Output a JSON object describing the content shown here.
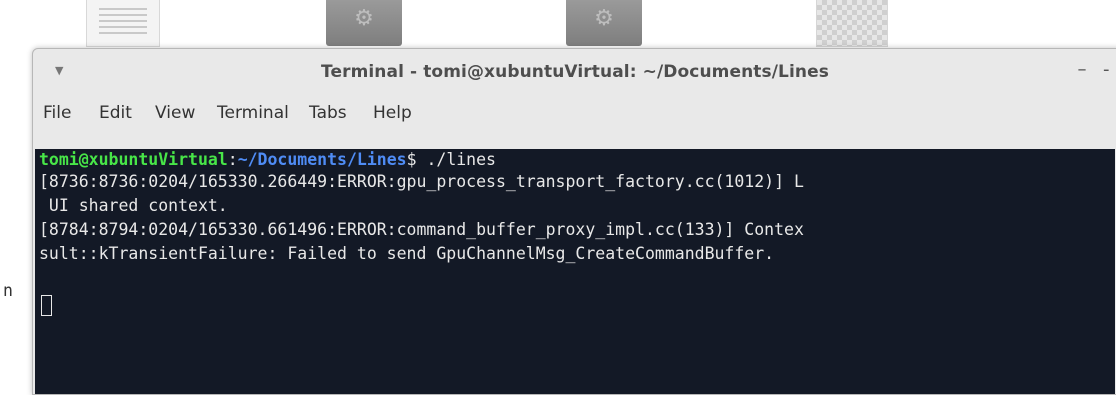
{
  "window": {
    "title": "Terminal - tomi@xubuntuVirtual: ~/Documents/Lines",
    "menu_icon": "chevron-down-icon",
    "minimize_label": "–",
    "extra_label": "-"
  },
  "menubar": {
    "items": [
      "File",
      "Edit",
      "View",
      "Terminal",
      "Tabs",
      "Help"
    ]
  },
  "terminal": {
    "prompt_user": "tomi@xubuntuVirtual",
    "prompt_sep": ":",
    "prompt_path": "~/Documents/Lines",
    "prompt_suffix": "$ ./lines",
    "lines": [
      "[8736:8736:0204/165330.266449:ERROR:gpu_process_transport_factory.cc(1012)] L",
      " UI shared context.",
      "[8784:8794:0204/165330.661496:ERROR:command_buffer_proxy_impl.cc(133)] Contex",
      "sult::kTransientFailure: Failed to send GpuChannelMsg_CreateCommandBuffer."
    ],
    "stray_char": "n"
  },
  "colors": {
    "terminal_bg": "#131926",
    "prompt_user": "#48e648",
    "prompt_path": "#4f8cf5",
    "text": "#e8e8e8"
  }
}
